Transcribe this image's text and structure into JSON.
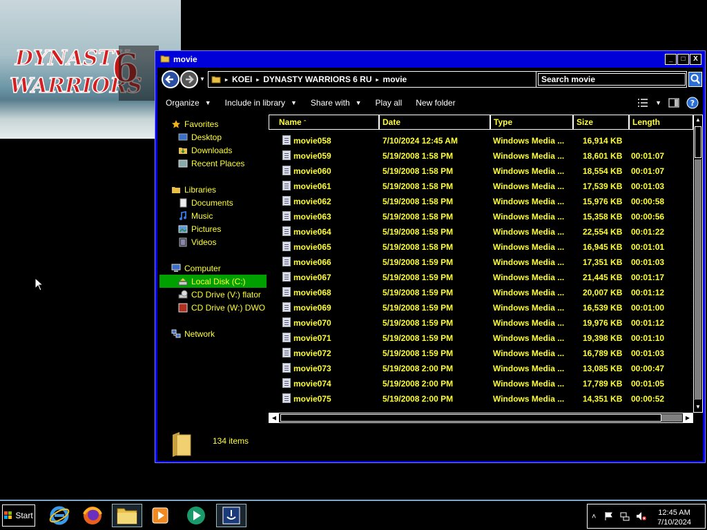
{
  "wallpaper": {
    "logo_line1": "DYNASTY",
    "logo_line2": "WARRIORS",
    "logo_number": "6"
  },
  "window": {
    "title": "movie",
    "controls": {
      "minimize": "_",
      "maximize": "□",
      "close": "X"
    }
  },
  "address": {
    "crumbs": [
      "KOEI",
      "DYNASTY WARRIORS 6 RU",
      "movie"
    ]
  },
  "search": {
    "placeholder": "Search movie"
  },
  "toolbar": {
    "organize": "Organize",
    "include_in_library": "Include in library",
    "share_with": "Share with",
    "play_all": "Play all",
    "new_folder": "New folder"
  },
  "nav": {
    "favorites": "Favorites",
    "desktop": "Desktop",
    "downloads": "Downloads",
    "recent_places": "Recent Places",
    "libraries": "Libraries",
    "documents": "Documents",
    "music": "Music",
    "pictures": "Pictures",
    "videos": "Videos",
    "computer": "Computer",
    "local_disk": "Local Disk (C:)",
    "cd_drive_v": "CD Drive (V:) flator",
    "cd_drive_w": "CD Drive (W:) DWO",
    "network": "Network"
  },
  "columns": {
    "name": "Name",
    "date": "Date",
    "type": "Type",
    "size": "Size",
    "length": "Length"
  },
  "files": [
    {
      "name": "movie058",
      "date": "7/10/2024 12:45 AM",
      "type": "Windows Media ...",
      "size": "16,914 KB",
      "length": ""
    },
    {
      "name": "movie059",
      "date": "5/19/2008 1:58 PM",
      "type": "Windows Media ...",
      "size": "18,601 KB",
      "length": "00:01:07"
    },
    {
      "name": "movie060",
      "date": "5/19/2008 1:58 PM",
      "type": "Windows Media ...",
      "size": "18,554 KB",
      "length": "00:01:07"
    },
    {
      "name": "movie061",
      "date": "5/19/2008 1:58 PM",
      "type": "Windows Media ...",
      "size": "17,539 KB",
      "length": "00:01:03"
    },
    {
      "name": "movie062",
      "date": "5/19/2008 1:58 PM",
      "type": "Windows Media ...",
      "size": "15,976 KB",
      "length": "00:00:58"
    },
    {
      "name": "movie063",
      "date": "5/19/2008 1:58 PM",
      "type": "Windows Media ...",
      "size": "15,358 KB",
      "length": "00:00:56"
    },
    {
      "name": "movie064",
      "date": "5/19/2008 1:58 PM",
      "type": "Windows Media ...",
      "size": "22,554 KB",
      "length": "00:01:22"
    },
    {
      "name": "movie065",
      "date": "5/19/2008 1:58 PM",
      "type": "Windows Media ...",
      "size": "16,945 KB",
      "length": "00:01:01"
    },
    {
      "name": "movie066",
      "date": "5/19/2008 1:59 PM",
      "type": "Windows Media ...",
      "size": "17,351 KB",
      "length": "00:01:03"
    },
    {
      "name": "movie067",
      "date": "5/19/2008 1:59 PM",
      "type": "Windows Media ...",
      "size": "21,445 KB",
      "length": "00:01:17"
    },
    {
      "name": "movie068",
      "date": "5/19/2008 1:59 PM",
      "type": "Windows Media ...",
      "size": "20,007 KB",
      "length": "00:01:12"
    },
    {
      "name": "movie069",
      "date": "5/19/2008 1:59 PM",
      "type": "Windows Media ...",
      "size": "16,539 KB",
      "length": "00:01:00"
    },
    {
      "name": "movie070",
      "date": "5/19/2008 1:59 PM",
      "type": "Windows Media ...",
      "size": "19,976 KB",
      "length": "00:01:12"
    },
    {
      "name": "movie071",
      "date": "5/19/2008 1:59 PM",
      "type": "Windows Media ...",
      "size": "19,398 KB",
      "length": "00:01:10"
    },
    {
      "name": "movie072",
      "date": "5/19/2008 1:59 PM",
      "type": "Windows Media ...",
      "size": "16,789 KB",
      "length": "00:01:03"
    },
    {
      "name": "movie073",
      "date": "5/19/2008 2:00 PM",
      "type": "Windows Media ...",
      "size": "13,085 KB",
      "length": "00:00:47"
    },
    {
      "name": "movie074",
      "date": "5/19/2008 2:00 PM",
      "type": "Windows Media ...",
      "size": "17,789 KB",
      "length": "00:01:05"
    },
    {
      "name": "movie075",
      "date": "5/19/2008 2:00 PM",
      "type": "Windows Media ...",
      "size": "14,351 KB",
      "length": "00:00:52"
    }
  ],
  "details": {
    "count": "134 items"
  },
  "taskbar": {
    "start": "Start",
    "time": "12:45 AM",
    "date": "7/10/2024"
  },
  "colors": {
    "text_highlight": "#ffff33",
    "selection": "#00a000",
    "title_bar": "#0000d8"
  }
}
